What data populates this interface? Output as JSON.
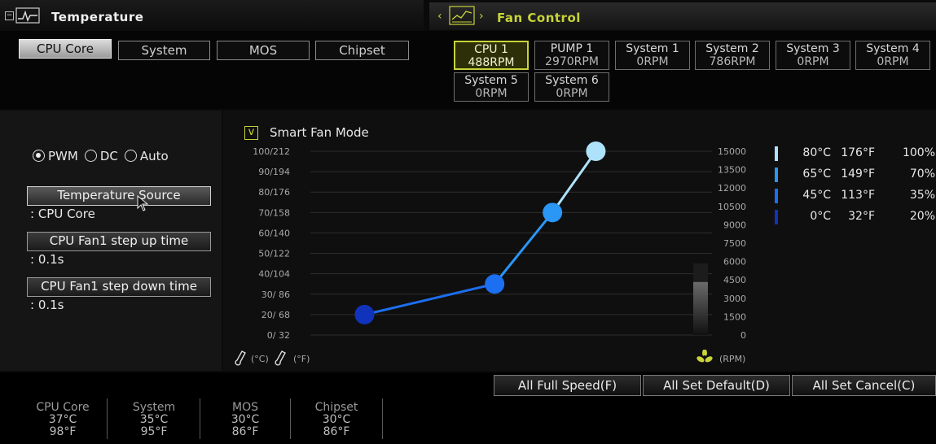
{
  "temperature_header": {
    "title": "Temperature",
    "icon": "thermometer-graph-icon"
  },
  "fan_header": {
    "title": "Fan Control",
    "icon": "fan-graph-icon"
  },
  "temp_tabs": [
    {
      "label": "CPU Core",
      "active": true
    },
    {
      "label": "System",
      "active": false
    },
    {
      "label": "MOS",
      "active": false
    },
    {
      "label": "Chipset",
      "active": false
    }
  ],
  "fans": [
    {
      "name": "CPU 1",
      "rpm": "488RPM",
      "active": true
    },
    {
      "name": "PUMP 1",
      "rpm": "2970RPM",
      "active": false
    },
    {
      "name": "System 1",
      "rpm": "0RPM",
      "active": false
    },
    {
      "name": "System 2",
      "rpm": "786RPM",
      "active": false
    },
    {
      "name": "System 3",
      "rpm": "0RPM",
      "active": false
    },
    {
      "name": "System 4",
      "rpm": "0RPM",
      "active": false
    },
    {
      "name": "System 5",
      "rpm": "0RPM",
      "active": false
    },
    {
      "name": "System 6",
      "rpm": "0RPM",
      "active": false
    }
  ],
  "mode": {
    "options": [
      "PWM",
      "DC",
      "Auto"
    ],
    "selected": "PWM"
  },
  "settings": {
    "temp_source_label": "Temperature Source",
    "temp_source_value": ": CPU Core",
    "step_up_label": "CPU Fan1 step up time",
    "step_up_value": ": 0.1s",
    "step_down_label": "CPU Fan1 step down time",
    "step_down_value": ": 0.1s"
  },
  "smart_fan": {
    "label": "Smart Fan Mode",
    "checked": true,
    "check_glyph": "v"
  },
  "chart_data": {
    "type": "line",
    "title": "",
    "x_unit_c": "(°C)",
    "x_unit_f": "(°F)",
    "y_right_unit": "(RPM)",
    "left_ticks": [
      "100/212",
      "90/194",
      "80/176",
      "70/158",
      "60/140",
      "50/122",
      "40/104",
      "30/ 86",
      "20/ 68",
      "0/ 32"
    ],
    "right_ticks": [
      "15000",
      "13500",
      "12000",
      "10500",
      "9000",
      "7500",
      "6000",
      "4500",
      "3000",
      "1500",
      "0"
    ],
    "points": [
      {
        "temp_c": 0,
        "temp_f": 32,
        "percent": 20,
        "color": "#1133bb"
      },
      {
        "temp_c": 45,
        "temp_f": 113,
        "percent": 35,
        "color": "#1c6ff0"
      },
      {
        "temp_c": 65,
        "temp_f": 149,
        "percent": 70,
        "color": "#2a96f5"
      },
      {
        "temp_c": 80,
        "temp_f": 176,
        "percent": 100,
        "color": "#aee2fb"
      }
    ],
    "rpm_meter_fraction": 0.2
  },
  "legend": [
    {
      "c": "80°C",
      "f": "176°F",
      "pct": "100%",
      "color": "#aee2fb"
    },
    {
      "c": "65°C",
      "f": "149°F",
      "pct": "70%",
      "color": "#2a96f5"
    },
    {
      "c": "45°C",
      "f": "113°F",
      "pct": "35%",
      "color": "#1c6ff0"
    },
    {
      "c": "0°C",
      "f": "32°F",
      "pct": "20%",
      "color": "#1133bb"
    }
  ],
  "actions": {
    "full_speed": "All Full Speed(F)",
    "set_default": "All Set Default(D)",
    "set_cancel": "All Set Cancel(C)"
  },
  "status": [
    {
      "name": "CPU Core",
      "c": "37°C",
      "f": "98°F"
    },
    {
      "name": "System",
      "c": "35°C",
      "f": "95°F"
    },
    {
      "name": "MOS",
      "c": "30°C",
      "f": "86°F"
    },
    {
      "name": "Chipset",
      "c": "30°C",
      "f": "86°F"
    }
  ]
}
